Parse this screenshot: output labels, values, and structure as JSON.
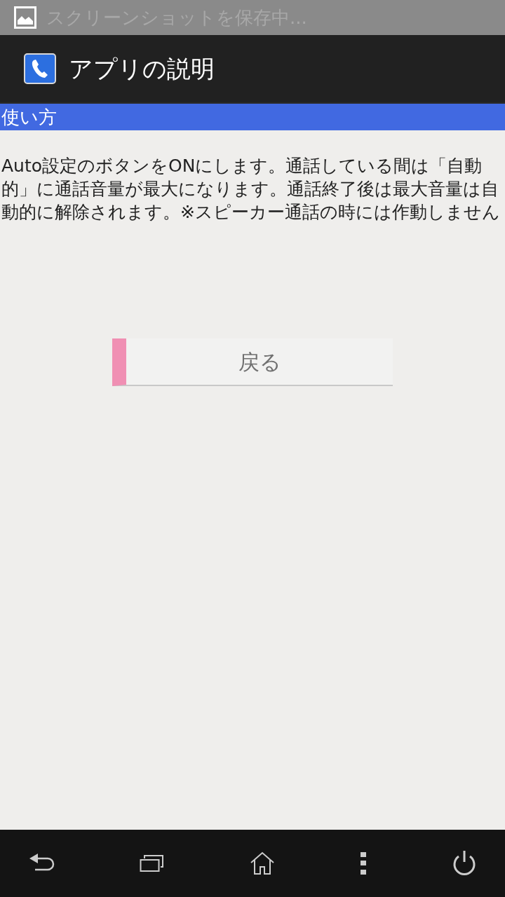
{
  "status_bar": {
    "notification": "スクリーンショットを保存中..."
  },
  "action_bar": {
    "title": "アプリの説明"
  },
  "section": {
    "header": "使い方",
    "body": "Auto設定のボタンをONにします。通話している間は「自動的」に通話音量が最大になります。通話終了後は最大音量は自動的に解除されます。※スピーカー通話の時には作動しません"
  },
  "button": {
    "label": "戻る"
  }
}
